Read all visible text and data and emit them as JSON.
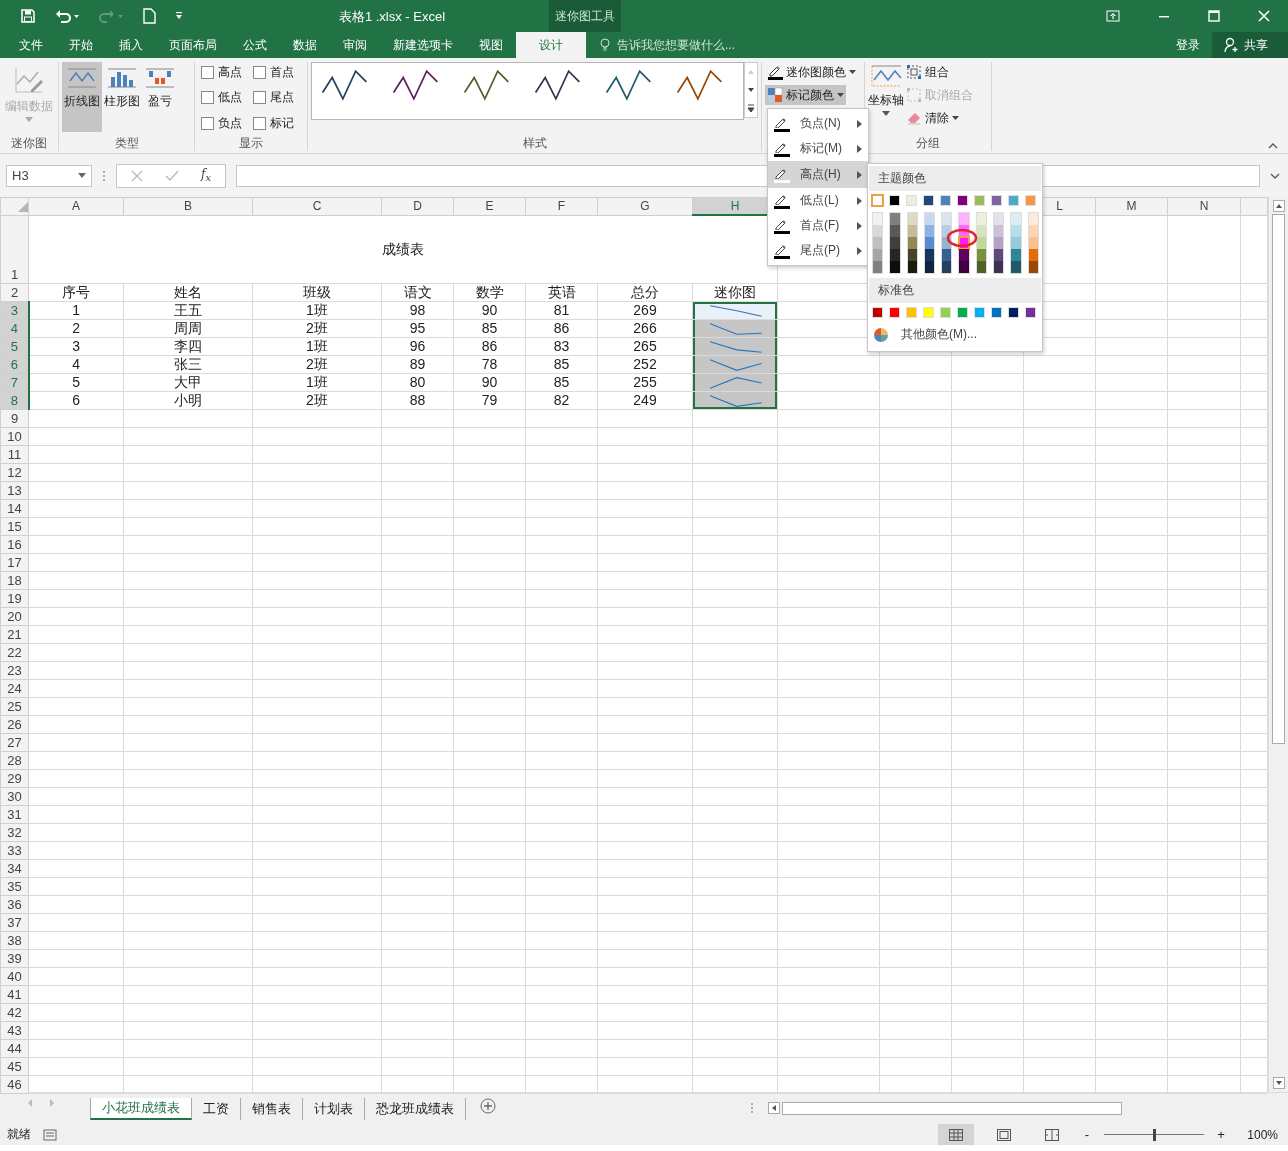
{
  "title_bar": {
    "title": "表格1 .xlsx - Excel",
    "context_label": "迷你图工具"
  },
  "ribbon_tabs": [
    {
      "label": "文件",
      "selected": false
    },
    {
      "label": "开始",
      "selected": false
    },
    {
      "label": "插入",
      "selected": false
    },
    {
      "label": "页面布局",
      "selected": false
    },
    {
      "label": "公式",
      "selected": false
    },
    {
      "label": "数据",
      "selected": false
    },
    {
      "label": "审阅",
      "selected": false
    },
    {
      "label": "新建选项卡",
      "selected": false
    },
    {
      "label": "视图",
      "selected": false
    },
    {
      "label": "设计",
      "selected": true
    }
  ],
  "tell_me": {
    "placeholder": "告诉我您想要做什么..."
  },
  "account": {
    "sign_in": "登录",
    "share": "共享"
  },
  "ribbon": {
    "sparkline_group": {
      "label": "迷你图",
      "edit": {
        "label": "编辑数据",
        "disabled": true
      }
    },
    "type_group": {
      "label": "类型",
      "buttons": [
        {
          "kind": "line",
          "label": "折线图",
          "selected": true
        },
        {
          "kind": "column",
          "label": "柱形图",
          "selected": false
        },
        {
          "kind": "winloss",
          "label": "盈亏",
          "selected": false
        }
      ]
    },
    "show_group": {
      "label": "显示",
      "checkboxes": [
        {
          "label": "高点",
          "checked": false
        },
        {
          "label": "首点",
          "checked": false
        },
        {
          "label": "低点",
          "checked": false
        },
        {
          "label": "尾点",
          "checked": false
        },
        {
          "label": "负点",
          "checked": false
        },
        {
          "label": "标记",
          "checked": false
        }
      ]
    },
    "style_group": {
      "label": "样式",
      "styles": [
        {
          "color": "#243f60"
        },
        {
          "color": "#5f1f5f"
        },
        {
          "color": "#4f6228"
        },
        {
          "color": "#3f3151"
        },
        {
          "color": "#215968"
        },
        {
          "color": "#974706"
        }
      ]
    },
    "color_group": {
      "buttons": [
        {
          "kind": "sparkline",
          "label": "迷你图颜色",
          "pressed": false
        },
        {
          "kind": "marker",
          "label": "标记颜色",
          "pressed": true
        }
      ]
    },
    "group_group": {
      "label": "分组",
      "axis": "坐标轴",
      "buttons": [
        {
          "kind": "group",
          "label": "组合",
          "disabled": false
        },
        {
          "kind": "ungroup",
          "label": "取消组合",
          "disabled": true
        },
        {
          "kind": "clear",
          "label": "清除",
          "disabled": false
        }
      ]
    }
  },
  "marker_menu": {
    "items": [
      {
        "label": "负点(N)",
        "selected": false,
        "color": "#000000"
      },
      {
        "label": "标记(M)",
        "selected": false,
        "color": "#000000"
      },
      {
        "label": "高点(H)",
        "selected": true,
        "color": "#ffffff"
      },
      {
        "label": "低点(L)",
        "selected": false,
        "color": "#000000"
      },
      {
        "label": "首点(F)",
        "selected": false,
        "color": "#000000"
      },
      {
        "label": "尾点(P)",
        "selected": false,
        "color": "#000000"
      }
    ]
  },
  "palette": {
    "theme_title": "主题颜色",
    "theme": [
      {
        "color": "#ffffff",
        "selected": true
      },
      {
        "color": "#000000",
        "selected": false
      },
      {
        "color": "#eeece1",
        "selected": false
      },
      {
        "color": "#1f497d",
        "selected": false
      },
      {
        "color": "#4f81bd",
        "selected": false
      },
      {
        "color": "#800080",
        "selected": false
      },
      {
        "color": "#9bbb59",
        "selected": false
      },
      {
        "color": "#8064a2",
        "selected": false
      },
      {
        "color": "#4bacc6",
        "selected": false
      },
      {
        "color": "#f79646",
        "selected": false
      }
    ],
    "shades": [
      {
        "swatches": [
          {
            "color": "#f2f2f2",
            "selected": false
          },
          {
            "color": "#d9d9d9",
            "selected": false
          },
          {
            "color": "#bfbfbf",
            "selected": false
          },
          {
            "color": "#a6a6a6",
            "selected": false
          },
          {
            "color": "#808080",
            "selected": false
          }
        ]
      },
      {
        "swatches": [
          {
            "color": "#7f7f7f",
            "selected": false
          },
          {
            "color": "#595959",
            "selected": false
          },
          {
            "color": "#3f3f3f",
            "selected": false
          },
          {
            "color": "#262626",
            "selected": false
          },
          {
            "color": "#0d0d0d",
            "selected": false
          }
        ]
      },
      {
        "swatches": [
          {
            "color": "#ddd9c3",
            "selected": false
          },
          {
            "color": "#c4bd97",
            "selected": false
          },
          {
            "color": "#938953",
            "selected": false
          },
          {
            "color": "#494429",
            "selected": false
          },
          {
            "color": "#1d1b10",
            "selected": false
          }
        ]
      },
      {
        "swatches": [
          {
            "color": "#c6d9f0",
            "selected": false
          },
          {
            "color": "#8db3e2",
            "selected": false
          },
          {
            "color": "#548dd4",
            "selected": false
          },
          {
            "color": "#17365d",
            "selected": false
          },
          {
            "color": "#0f243e",
            "selected": false
          }
        ]
      },
      {
        "swatches": [
          {
            "color": "#dbe5f1",
            "selected": false
          },
          {
            "color": "#b8cce4",
            "selected": false
          },
          {
            "color": "#95b3d7",
            "selected": false
          },
          {
            "color": "#366092",
            "selected": false
          },
          {
            "color": "#244061",
            "selected": false
          }
        ]
      },
      {
        "swatches": [
          {
            "color": "#ffb3ff",
            "selected": false
          },
          {
            "color": "#ff66ff",
            "selected": false
          },
          {
            "color": "#ff19ff",
            "selected": true
          },
          {
            "color": "#600060",
            "selected": false
          },
          {
            "color": "#400040",
            "selected": false
          }
        ]
      },
      {
        "swatches": [
          {
            "color": "#ebf1dd",
            "selected": false
          },
          {
            "color": "#d7e3bc",
            "selected": false
          },
          {
            "color": "#c3d69b",
            "selected": false
          },
          {
            "color": "#76923c",
            "selected": false
          },
          {
            "color": "#4f6128",
            "selected": false
          }
        ]
      },
      {
        "swatches": [
          {
            "color": "#e5e0ec",
            "selected": false
          },
          {
            "color": "#ccc1d9",
            "selected": false
          },
          {
            "color": "#b2a2c7",
            "selected": false
          },
          {
            "color": "#5f497a",
            "selected": false
          },
          {
            "color": "#3f3151",
            "selected": false
          }
        ]
      },
      {
        "swatches": [
          {
            "color": "#dbeef3",
            "selected": false
          },
          {
            "color": "#b7dde8",
            "selected": false
          },
          {
            "color": "#92cddc",
            "selected": false
          },
          {
            "color": "#31859b",
            "selected": false
          },
          {
            "color": "#205867",
            "selected": false
          }
        ]
      },
      {
        "swatches": [
          {
            "color": "#fdeada",
            "selected": false
          },
          {
            "color": "#fbd5b5",
            "selected": false
          },
          {
            "color": "#fac08f",
            "selected": false
          },
          {
            "color": "#e36c09",
            "selected": false
          },
          {
            "color": "#974806",
            "selected": false
          }
        ]
      }
    ],
    "standard_title": "标准色",
    "standard": [
      {
        "color": "#c00000",
        "selected": false
      },
      {
        "color": "#ff0000",
        "selected": false
      },
      {
        "color": "#ffc000",
        "selected": false
      },
      {
        "color": "#ffff00",
        "selected": false
      },
      {
        "color": "#92d050",
        "selected": false
      },
      {
        "color": "#00b050",
        "selected": false
      },
      {
        "color": "#00b0f0",
        "selected": false
      },
      {
        "color": "#0070c0",
        "selected": false
      },
      {
        "color": "#002060",
        "selected": false
      },
      {
        "color": "#7030a0",
        "selected": false
      }
    ],
    "more": "其他颜色(M)..."
  },
  "formula_bar": {
    "name_box": "H3",
    "function_label": "f$_{x}$"
  },
  "sheet": {
    "columns_left": [
      {
        "label": "A",
        "selected": false
      },
      {
        "label": "B",
        "selected": false
      },
      {
        "label": "C",
        "selected": false
      },
      {
        "label": "D",
        "selected": false
      },
      {
        "label": "E",
        "selected": false
      },
      {
        "label": "F",
        "selected": false
      },
      {
        "label": "G",
        "selected": false
      },
      {
        "label": "H",
        "selected": true
      }
    ],
    "columns_right": [
      {
        "label": "L",
        "selected": false
      },
      {
        "label": "M",
        "selected": false
      },
      {
        "label": "N",
        "selected": false
      }
    ],
    "row_headers": [
      {
        "label": "1",
        "selected": false
      },
      {
        "label": "2",
        "selected": false
      },
      {
        "label": "3",
        "selected": true
      },
      {
        "label": "4",
        "selected": true
      },
      {
        "label": "5",
        "selected": true
      },
      {
        "label": "6",
        "selected": true
      },
      {
        "label": "7",
        "selected": true
      },
      {
        "label": "8",
        "selected": true
      },
      {
        "label": "9",
        "selected": false
      },
      {
        "label": "10",
        "selected": false
      },
      {
        "label": "11",
        "selected": false
      },
      {
        "label": "12",
        "selected": false
      },
      {
        "label": "13",
        "selected": false
      },
      {
        "label": "14",
        "selected": false
      },
      {
        "label": "15",
        "selected": false
      },
      {
        "label": "16",
        "selected": false
      },
      {
        "label": "17",
        "selected": false
      },
      {
        "label": "18",
        "selected": false
      },
      {
        "label": "19",
        "selected": false
      },
      {
        "label": "20",
        "selected": false
      },
      {
        "label": "21",
        "selected": false
      },
      {
        "label": "22",
        "selected": false
      },
      {
        "label": "23",
        "selected": false
      },
      {
        "label": "24",
        "selected": false
      },
      {
        "label": "25",
        "selected": false
      },
      {
        "label": "26",
        "selected": false
      },
      {
        "label": "27",
        "selected": false
      },
      {
        "label": "28",
        "selected": false
      },
      {
        "label": "29",
        "selected": false
      },
      {
        "label": "30",
        "selected": false
      },
      {
        "label": "31",
        "selected": false
      },
      {
        "label": "32",
        "selected": false
      },
      {
        "label": "33",
        "selected": false
      },
      {
        "label": "34",
        "selected": false
      },
      {
        "label": "35",
        "selected": false
      },
      {
        "label": "36",
        "selected": false
      },
      {
        "label": "37",
        "selected": false
      },
      {
        "label": "38",
        "selected": false
      },
      {
        "label": "39",
        "selected": false
      },
      {
        "label": "40",
        "selected": false
      },
      {
        "label": "41",
        "selected": false
      },
      {
        "label": "42",
        "selected": false
      },
      {
        "label": "43",
        "selected": false
      },
      {
        "label": "44",
        "selected": false
      },
      {
        "label": "45",
        "selected": false
      },
      {
        "label": "46",
        "selected": false
      }
    ]
  },
  "table": {
    "title": "成绩表",
    "header": [
      "序号",
      "姓名",
      "班级",
      "语文",
      "数学",
      "英语",
      "总分",
      "迷你图"
    ],
    "rows": [
      {
        "cells": [
          "1",
          "王五",
          "1班",
          "98",
          "90",
          "81",
          "269"
        ],
        "selected": true,
        "active": true
      },
      {
        "cells": [
          "2",
          "周周",
          "2班",
          "95",
          "85",
          "86",
          "266"
        ],
        "selected": true,
        "active": false
      },
      {
        "cells": [
          "3",
          "李四",
          "1班",
          "96",
          "86",
          "83",
          "265"
        ],
        "selected": true,
        "active": false
      },
      {
        "cells": [
          "4",
          "张三",
          "2班",
          "89",
          "78",
          "85",
          "252"
        ],
        "selected": true,
        "active": false
      },
      {
        "cells": [
          "5",
          "大甲",
          "1班",
          "80",
          "90",
          "85",
          "255"
        ],
        "selected": true,
        "active": false
      },
      {
        "cells": [
          "6",
          "小明",
          "2班",
          "88",
          "79",
          "82",
          "249"
        ],
        "selected": true,
        "active": false
      }
    ]
  },
  "sheet_tabs": [
    {
      "label": "小花班成绩表",
      "selected": true
    },
    {
      "label": "工资",
      "selected": false
    },
    {
      "label": "销售表",
      "selected": false
    },
    {
      "label": "计划表",
      "selected": false
    },
    {
      "label": "恐龙班成绩表",
      "selected": false
    }
  ],
  "status_bar": {
    "ready": "就绪",
    "views": [
      {
        "kind": "normal",
        "selected": true
      },
      {
        "kind": "layout",
        "selected": false
      },
      {
        "kind": "pagebreak",
        "selected": false
      }
    ],
    "zoom_out": "-",
    "zoom_in": "+",
    "zoom_slider": {
      "level": 0.5
    },
    "zoom": "100%"
  }
}
